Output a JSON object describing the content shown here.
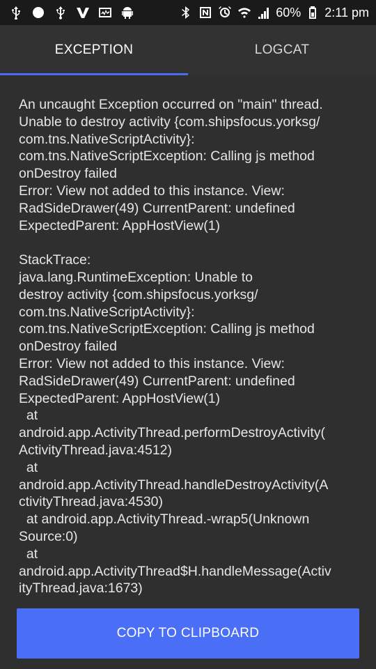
{
  "status_bar": {
    "battery": "60%",
    "time": "2:11 pm",
    "left_icons": [
      "usb-icon",
      "circle-icon",
      "usb-debug-icon",
      "v-app-icon",
      "activity-icon",
      "android-icon"
    ],
    "right_icons": [
      "bluetooth-icon",
      "nfc-icon",
      "alarm-icon",
      "wifi-icon",
      "signal-icon",
      "battery-icon"
    ]
  },
  "tabs": [
    {
      "label": "EXCEPTION",
      "active": true
    },
    {
      "label": "LOGCAT",
      "active": false
    }
  ],
  "message": {
    "lines": [
      "An uncaught Exception occurred on \"main\" thread.",
      "Unable to destroy activity {com.shipsfocus.yorksg/",
      "com.tns.NativeScriptActivity}:",
      "com.tns.NativeScriptException: Calling js method",
      "onDestroy failed",
      "Error: View not added to this instance. View:",
      "RadSideDrawer(49) CurrentParent: undefined",
      "ExpectedParent: AppHostView(1)"
    ]
  },
  "stacktrace": {
    "lines": [
      "StackTrace:",
      "java.lang.RuntimeException: Unable to",
      "destroy activity {com.shipsfocus.yorksg/",
      "com.tns.NativeScriptActivity}:",
      "com.tns.NativeScriptException: Calling js method",
      "onDestroy failed",
      "Error: View not added to this instance. View:",
      "RadSideDrawer(49) CurrentParent: undefined",
      "ExpectedParent: AppHostView(1)",
      "  at",
      "android.app.ActivityThread.performDestroyActivity(",
      "ActivityThread.java:4512)",
      "  at",
      "android.app.ActivityThread.handleDestroyActivity(A",
      "ctivityThread.java:4530)",
      "  at android.app.ActivityThread.-wrap5(Unknown",
      "Source:0)",
      "  at",
      "android.app.ActivityThread$H.handleMessage(Activ",
      "ityThread.java:1673)"
    ]
  },
  "copy_button": {
    "label": "COPY TO CLIPBOARD"
  },
  "colors": {
    "accent": "#4a6ef5",
    "background": "#2f2f2f",
    "status_bar": "#1a1a1a",
    "text": "#e6e6e6"
  }
}
